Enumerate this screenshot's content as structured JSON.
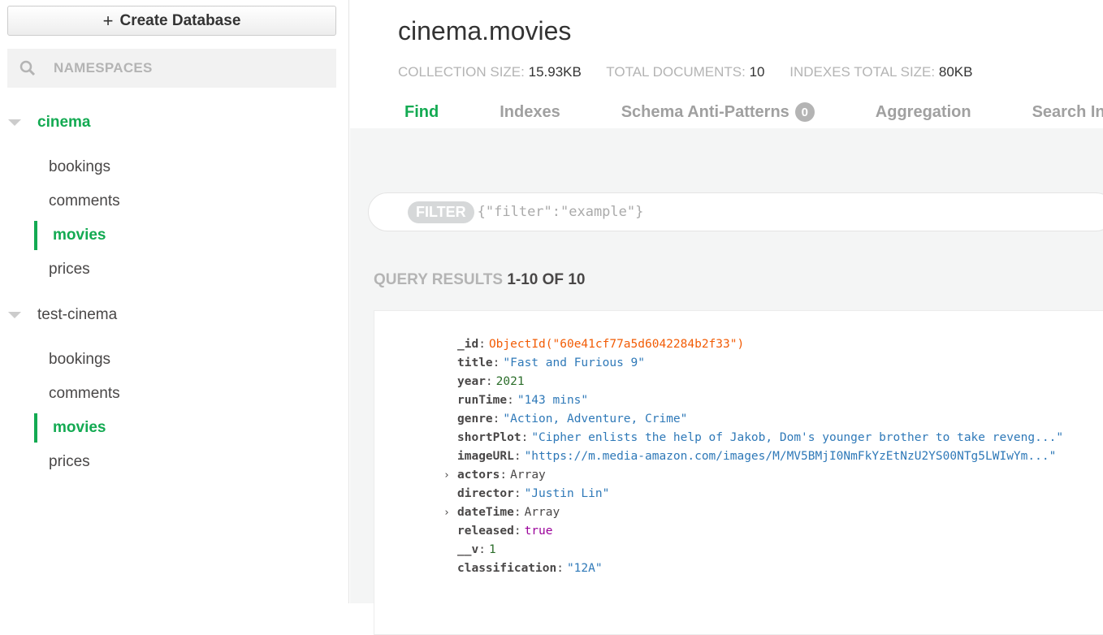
{
  "sidebar": {
    "create_label": "Create Database",
    "search_placeholder": "NAMESPACES",
    "databases": [
      {
        "name": "cinema",
        "collections": [
          "bookings",
          "comments",
          "movies",
          "prices"
        ],
        "active": "movies"
      },
      {
        "name": "test-cinema",
        "collections": [
          "bookings",
          "comments",
          "movies",
          "prices"
        ],
        "active": "movies"
      }
    ]
  },
  "header": {
    "title": "cinema.movies",
    "stats": [
      {
        "label": "COLLECTION SIZE:",
        "value": "15.93KB"
      },
      {
        "label": "TOTAL DOCUMENTS:",
        "value": "10"
      },
      {
        "label": "INDEXES TOTAL SIZE:",
        "value": "80KB"
      }
    ],
    "tabs": [
      "Find",
      "Indexes",
      "Schema Anti-Patterns",
      "Aggregation",
      "Search In"
    ],
    "anti_patterns_count": "0"
  },
  "filter": {
    "label": "FILTER",
    "placeholder": "{\"filter\":\"example\"}"
  },
  "results": {
    "label": "QUERY RESULTS",
    "range": "1-10 OF 10"
  },
  "document": [
    {
      "key": "_id",
      "value": "ObjectId(\"60e41cf77a5d6042284b2f33\")",
      "type": "oid"
    },
    {
      "key": "title",
      "value": "\"Fast and Furious 9\"",
      "type": "s"
    },
    {
      "key": "year",
      "value": "2021",
      "type": "n1"
    },
    {
      "key": "runTime",
      "value": "\"143 mins\"",
      "type": "s"
    },
    {
      "key": "genre",
      "value": "\"Action, Adventure, Crime\"",
      "type": "s"
    },
    {
      "key": "shortPlot",
      "value": "\"Cipher enlists the help of Jakob, Dom's younger brother to take reveng...\"",
      "type": "s"
    },
    {
      "key": "imageURL",
      "value": "\"https://m.media-amazon.com/images/M/MV5BMjI0NmFkYzEtNzU2YS00NTg5LWIwYm...\"",
      "type": "s"
    },
    {
      "key": "actors",
      "value": "Array",
      "type": "arr",
      "expandable": true
    },
    {
      "key": "director",
      "value": "\"Justin Lin\"",
      "type": "s"
    },
    {
      "key": "dateTime",
      "value": "Array",
      "type": "arr",
      "expandable": true
    },
    {
      "key": "released",
      "value": "true",
      "type": "b"
    },
    {
      "key": "__v",
      "value": "1",
      "type": "n1"
    },
    {
      "key": "classification",
      "value": "\"12A\"",
      "type": "s"
    }
  ],
  "colors": {
    "accent": "#13aa52",
    "string": "#2f79b8",
    "objectid": "#f25c05",
    "number": "#2c6e2b",
    "boolean": "#9a009a"
  }
}
